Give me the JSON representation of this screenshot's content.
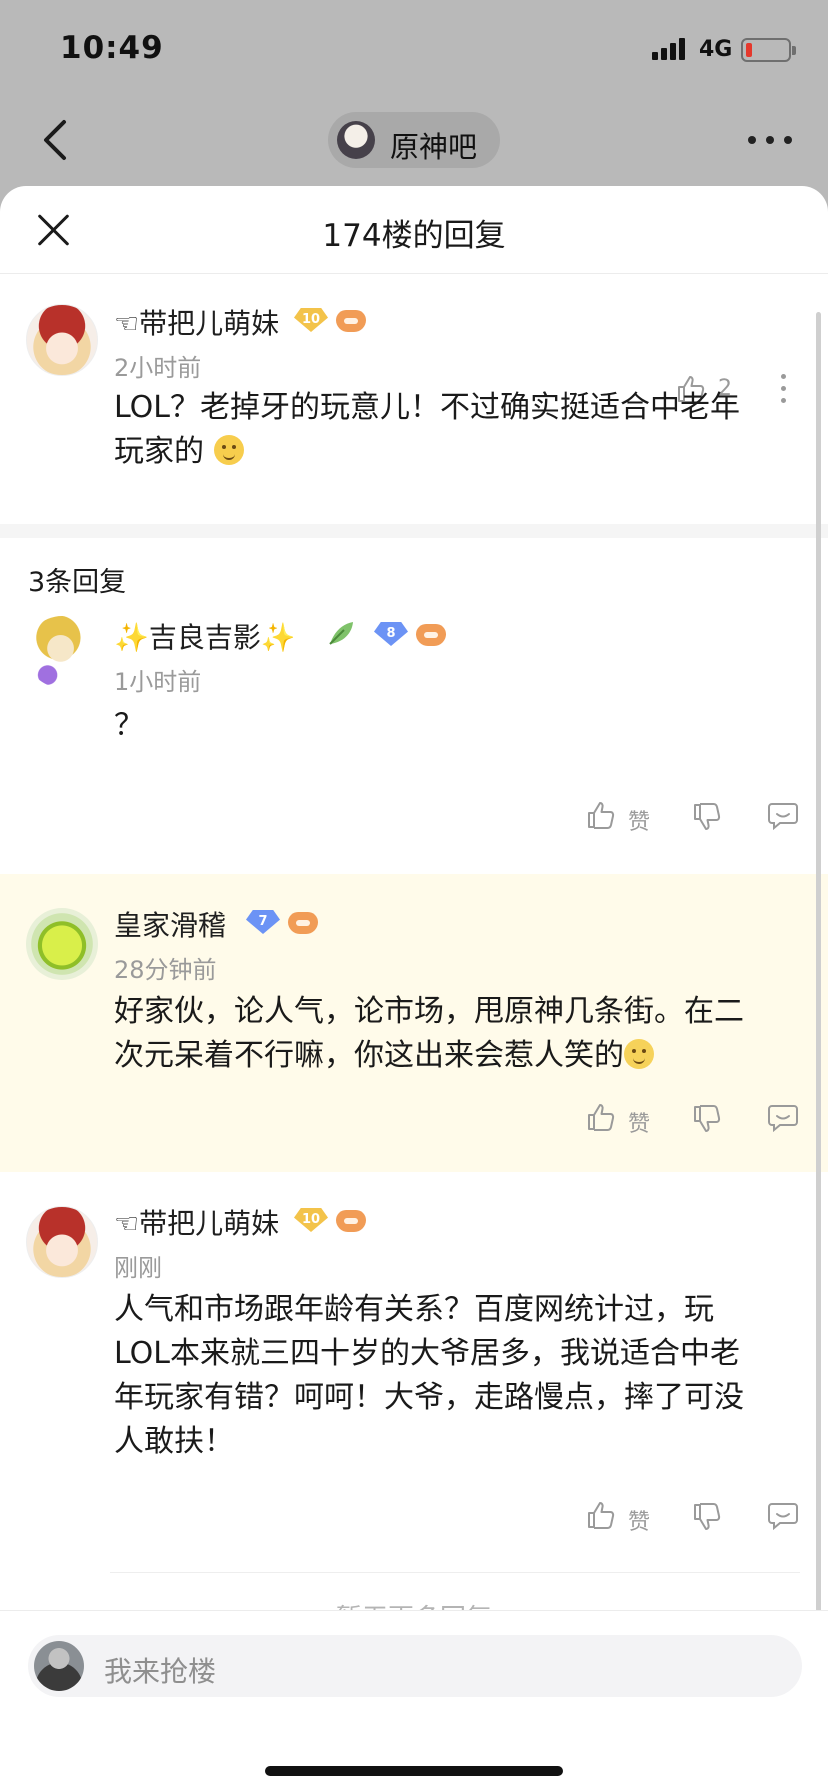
{
  "status_bar": {
    "time": "10:49",
    "network": "4G"
  },
  "nav": {
    "forum_name": "原神吧"
  },
  "sheet": {
    "title": "174楼的回复"
  },
  "main_post": {
    "username": "☜带把儿萌妹",
    "level": "10",
    "time": "2小时前",
    "like_count": "2",
    "content_line1": "LOL？老掉牙的玩意儿！不过确实挺适合中老年",
    "content_line2": "玩家的"
  },
  "replies_header": "3条回复",
  "replies": [
    {
      "username": "✨吉良吉影✨",
      "level": "8",
      "time": "1小时前",
      "content": "？",
      "like_label": "赞"
    },
    {
      "username": "皇家滑稽",
      "level": "7",
      "time": "28分钟前",
      "content_line1": "好家伙，论人气，论市场，甩原神几条街。在二",
      "content_line2": "次元呆着不行嘛，你这出来会惹人笑的",
      "like_label": "赞"
    },
    {
      "username": "☜带把儿萌妹",
      "level": "10",
      "time": "刚刚",
      "content_line1": "人气和市场跟年龄有关系？百度网统计过，玩",
      "content_line2": "LOL本来就三四十岁的大爷居多，我说适合中老",
      "content_line3": "年玩家有错？呵呵！大爷，走路慢点，摔了可没",
      "content_line4": "人敢扶！",
      "like_label": "赞"
    }
  ],
  "more_replies": "暂无更多回复",
  "input": {
    "placeholder": "我来抢楼"
  },
  "colors": {
    "highlight_bg": "#fffbea",
    "gold_badge": "#f3c34a",
    "blue_badge": "#6c93f5",
    "text_gray": "#9a9a9a"
  }
}
